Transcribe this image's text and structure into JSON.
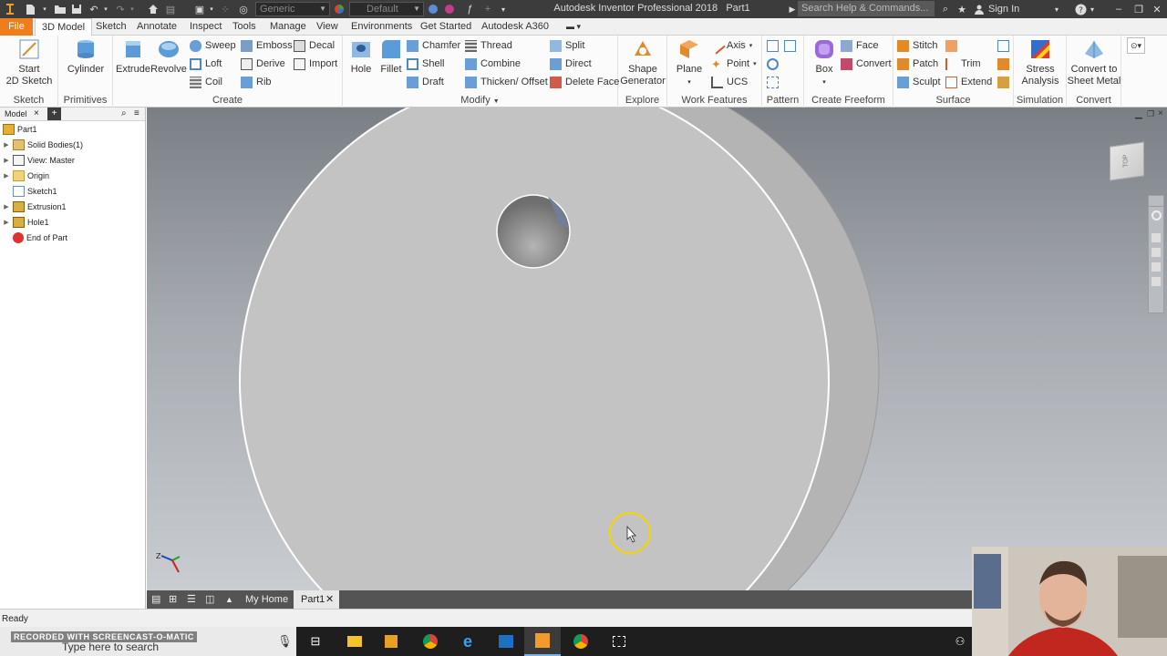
{
  "title_bar": {
    "title": "Autodesk Inventor Professional 2018",
    "document": "Part1",
    "material_combo": "Generic",
    "appearance_combo": "Default",
    "search_placeholder": "Search Help & Commands...",
    "sign_in": "Sign In"
  },
  "menu": {
    "file": "File",
    "tabs": [
      "3D Model",
      "Sketch",
      "Annotate",
      "Inspect",
      "Tools",
      "Manage",
      "View",
      "Environments",
      "Get Started",
      "Autodesk A360"
    ]
  },
  "ribbon": {
    "sketch": {
      "title": "Sketch",
      "start_sketch": [
        "Start",
        "2D Sketch"
      ]
    },
    "primitives": {
      "title": "Primitives",
      "cylinder": "Cylinder"
    },
    "create": {
      "title": "Create",
      "extrude": "Extrude",
      "revolve": "Revolve",
      "sweep": "Sweep",
      "loft": "Loft",
      "coil": "Coil",
      "emboss": "Emboss",
      "derive": "Derive",
      "rib": "Rib",
      "decal": "Decal",
      "import": "Import"
    },
    "modify": {
      "title": "Modify",
      "hole": "Hole",
      "fillet": "Fillet",
      "chamfer": "Chamfer",
      "shell": "Shell",
      "draft": "Draft",
      "thread": "Thread",
      "combine": "Combine",
      "thicken": "Thicken/ Offset",
      "split": "Split",
      "direct": "Direct",
      "delete_face": "Delete Face"
    },
    "explore": {
      "title": "Explore",
      "shape_generator": [
        "Shape",
        "Generator"
      ]
    },
    "work_features": {
      "title": "Work Features",
      "plane": "Plane",
      "axis": "Axis",
      "point": "Point",
      "ucs": "UCS"
    },
    "pattern": {
      "title": "Pattern"
    },
    "freeform": {
      "title": "Create Freeform",
      "box": "Box",
      "face": "Face",
      "convert": "Convert"
    },
    "surface": {
      "title": "Surface",
      "stitch": "Stitch",
      "patch": "Patch",
      "sculpt": "Sculpt",
      "trim": "Trim",
      "extend": "Extend"
    },
    "simulation": {
      "title": "Simulation",
      "stress": [
        "Stress",
        "Analysis"
      ]
    },
    "convert": {
      "title": "Convert",
      "sheet_metal": [
        "Convert to",
        "Sheet Metal"
      ]
    }
  },
  "browser": {
    "tab": "Model",
    "items": [
      {
        "label": "Part1",
        "level": 0,
        "icon": "part-icon"
      },
      {
        "label": "Solid Bodies(1)",
        "level": 1,
        "icon": "solid-bodies-icon"
      },
      {
        "label": "View: Master",
        "level": 1,
        "icon": "view-icon"
      },
      {
        "label": "Origin",
        "level": 1,
        "icon": "folder-icon"
      },
      {
        "label": "Sketch1",
        "level": 1,
        "icon": "sketch-icon"
      },
      {
        "label": "Extrusion1",
        "level": 1,
        "icon": "extrusion-icon"
      },
      {
        "label": "Hole1",
        "level": 1,
        "icon": "hole-icon"
      },
      {
        "label": "End of Part",
        "level": 1,
        "icon": "end-of-part-icon"
      }
    ]
  },
  "viewcube_label": "TOP",
  "doc_tabs": {
    "home": "My Home",
    "part": "Part1"
  },
  "status": "Ready",
  "taskbar": {
    "search_placeholder": "Type here to search",
    "watermark": "RECORDED WITH SCREENCAST-O-MATIC"
  },
  "colors": {
    "title_bar": "#3c3c3c",
    "file_tab": "#f07d1b",
    "viewport_top": "#7a7f86",
    "viewport_bottom": "#c9ccd1",
    "part_face": "#c3c3c3",
    "cursor_highlight": "#f2d600"
  }
}
